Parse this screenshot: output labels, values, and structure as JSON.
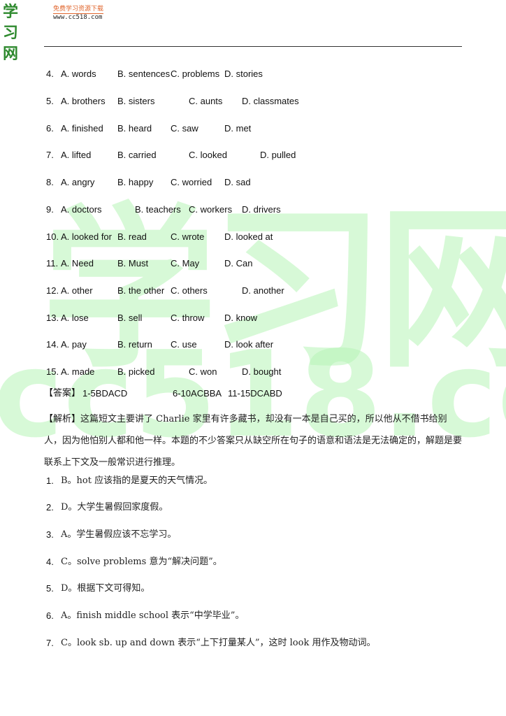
{
  "header": {
    "logo_text": "学习网",
    "tagline": "免费学习资源下载",
    "url": "www.cc518.com"
  },
  "watermark": {
    "chinese": "学习网",
    "url": "cc518.com"
  },
  "questions": [
    {
      "num": "4.",
      "options": [
        "A. words",
        "B. sentences",
        "C. problems",
        "D. stories"
      ]
    },
    {
      "num": "5.",
      "options": [
        "A. brothers",
        "B. sisters",
        "C. aunts",
        "D. classmates"
      ]
    },
    {
      "num": "6.",
      "options": [
        "A. finished",
        "B. heard",
        "C. saw",
        "D. met"
      ]
    },
    {
      "num": "7.",
      "options": [
        "A. lifted",
        "B. carried",
        "C. looked",
        "D. pulled"
      ]
    },
    {
      "num": "8.",
      "options": [
        "A. angry",
        "B. happy",
        "C. worried",
        "D. sad"
      ]
    },
    {
      "num": "9.",
      "options": [
        "A. doctors",
        "B. teachers",
        "C. workers",
        "D. drivers"
      ]
    },
    {
      "num": "10.",
      "options": [
        "A. looked for",
        "B. read",
        "C. wrote",
        "D. looked at"
      ]
    },
    {
      "num": "11.",
      "options": [
        "A. Need",
        "B. Must",
        "C. May",
        "D. Can"
      ]
    },
    {
      "num": "12.",
      "options": [
        "A. other",
        "B. the other",
        "C. others",
        "D. another"
      ]
    },
    {
      "num": "13.",
      "options": [
        "A. lose",
        "B. sell",
        "C. throw",
        "D. know"
      ]
    },
    {
      "num": "14.",
      "options": [
        "A. pay",
        "B. return",
        "C. use",
        "D. look after"
      ]
    },
    {
      "num": "15.",
      "options": [
        "A. made",
        "B. picked",
        "C. won",
        "D. bought"
      ]
    }
  ],
  "answer": {
    "label": "【答案】",
    "groups": [
      "1-5BDACD",
      "6-10ACBBA",
      "11-15DCABD"
    ]
  },
  "analysis": {
    "label": "【解析】",
    "text": "这篇短文主要讲了 Charlie 家里有许多藏书，却没有一本是自己买的，所以他从不借书给别人，因为他怕别人都和他一样。本题的不少答案只从缺空所在句子的语意和语法是无法确定的，解题是要联系上下文及一般常识进行推理。"
  },
  "explanations": [
    {
      "num": "1.",
      "text": "B。hot 应该指的是夏天的天气情况。"
    },
    {
      "num": "2.",
      "text": "D。大学生暑假回家度假。"
    },
    {
      "num": "3.",
      "text": "A。学生暑假应该不忘学习。"
    },
    {
      "num": "4.",
      "text": "C。solve problems 意为“解决问题”。"
    },
    {
      "num": "5.",
      "text": "D。根据下文可得知。"
    },
    {
      "num": "6.",
      "text": "A。finish middle school 表示“中学毕业”。"
    },
    {
      "num": "7.",
      "text": "C。look sb. up and down 表示“上下打量某人”，这时 look 用作及物动词。"
    }
  ]
}
